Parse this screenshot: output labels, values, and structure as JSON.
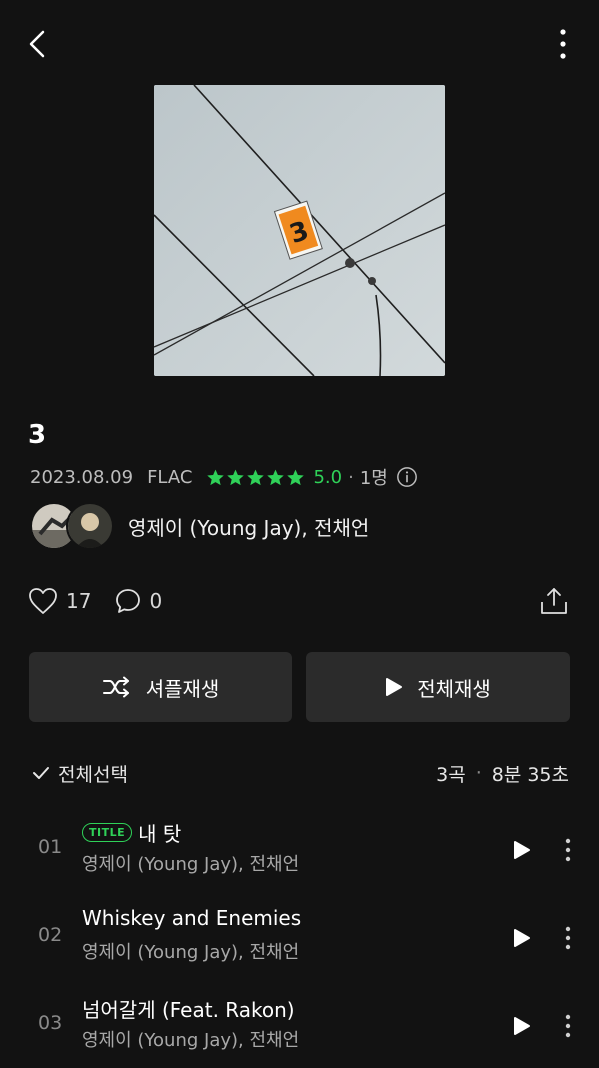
{
  "album": {
    "title": "3",
    "release_date": "2023.08.09",
    "format": "FLAC",
    "rating": "5.0",
    "rating_count": "1명",
    "artist": "영제이 (Young Jay), 전채언",
    "cover_number": "3"
  },
  "stats": {
    "likes": "17",
    "comments": "0"
  },
  "buttons": {
    "shuffle_label": "셔플재생",
    "play_all_label": "전체재생"
  },
  "list_header": {
    "select_all_label": "전체선택",
    "track_count": "3곡",
    "separator": "·",
    "duration": "8분 35초"
  },
  "tracks": [
    {
      "number": "01",
      "badge": "TITLE",
      "title": "내 탓",
      "artist": "영제이 (Young Jay), 전채언"
    },
    {
      "number": "02",
      "title": "Whiskey and Enemies",
      "artist": "영제이 (Young Jay), 전채언"
    },
    {
      "number": "03",
      "title": "넘어갈게 (Feat. Rakon)",
      "artist": "영제이 (Young Jay), 전채언"
    }
  ],
  "colors": {
    "background": "#121212",
    "accent_green": "#2fd158",
    "button_bg": "#2b2b2b"
  },
  "icons": [
    "back-arrow-icon",
    "more-vertical-icon",
    "star-icon",
    "info-icon",
    "heart-icon",
    "comment-icon",
    "share-icon",
    "shuffle-icon",
    "play-icon",
    "check-icon"
  ]
}
